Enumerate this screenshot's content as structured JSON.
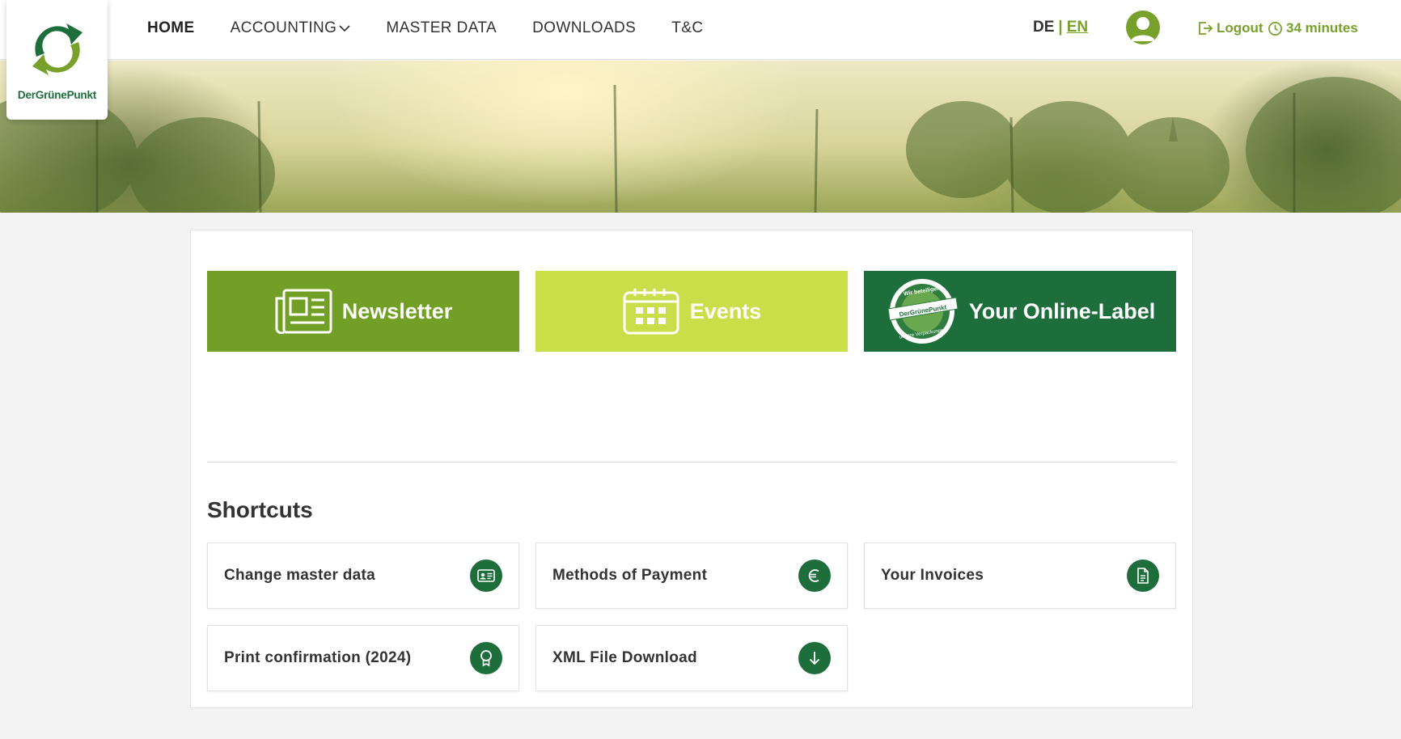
{
  "brand": {
    "name": "DerGrünePunkt"
  },
  "nav": {
    "items": [
      {
        "label": "HOME",
        "active": true
      },
      {
        "label": "ACCOUNTING",
        "dropdown": true
      },
      {
        "label": "MASTER DATA"
      },
      {
        "label": "DOWNLOADS"
      },
      {
        "label": "T&C"
      }
    ]
  },
  "language": {
    "de": "DE",
    "separator": "|",
    "en": "EN",
    "selected": "EN"
  },
  "session": {
    "logout_label": "Logout",
    "timer_label": "34 minutes"
  },
  "tiles": [
    {
      "label": "Newsletter",
      "icon": "newspaper-icon",
      "color": "#729f25"
    },
    {
      "label": "Events",
      "icon": "calendar-icon",
      "color": "#c8df4a"
    },
    {
      "label": "Your Online-Label",
      "icon": "online-label-badge-icon",
      "color": "#1e6e3c",
      "badge_text": {
        "top": "Wir beteiligen",
        "middle": "DerGrünePunkt",
        "bottom": "unsere Verpackungen"
      }
    }
  ],
  "shortcuts": {
    "title": "Shortcuts",
    "items": [
      {
        "label": "Change master data",
        "icon": "id-card-icon"
      },
      {
        "label": "Methods of Payment",
        "icon": "euro-icon"
      },
      {
        "label": "Your Invoices",
        "icon": "document-icon"
      },
      {
        "label": "Print confirmation (2024)",
        "icon": "award-icon"
      },
      {
        "label": "XML File Download",
        "icon": "download-arrow-icon"
      }
    ]
  },
  "colors": {
    "green": "#77a12b",
    "dark_green": "#1e6e3c",
    "lime": "#c8df4a"
  }
}
